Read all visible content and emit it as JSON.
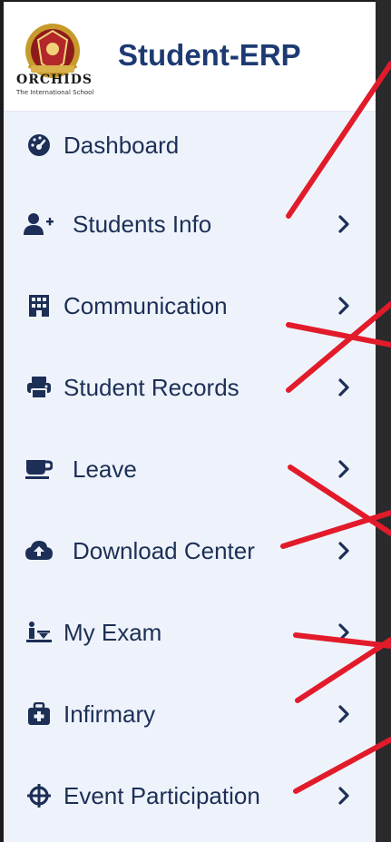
{
  "header": {
    "brand": "Student-ERP",
    "logo_name": "ORCHIDS",
    "logo_subtitle": "The International School"
  },
  "colors": {
    "sidebar_bg": "#eef3fb",
    "text": "#1d2f57",
    "brand": "#1d3a73",
    "annotation": "#e21b2b"
  },
  "sidebar": {
    "items": [
      {
        "label": "Dashboard",
        "icon": "dashboard-icon",
        "has_chevron": false
      },
      {
        "label": "Students Info",
        "icon": "add-user-icon",
        "has_chevron": true
      },
      {
        "label": "Communication",
        "icon": "building-icon",
        "has_chevron": true
      },
      {
        "label": "Student Records",
        "icon": "printer-icon",
        "has_chevron": true
      },
      {
        "label": "Leave",
        "icon": "coffee-cup-icon",
        "has_chevron": true
      },
      {
        "label": "Download Center",
        "icon": "cloud-download-icon",
        "has_chevron": true
      },
      {
        "label": "My Exam",
        "icon": "exam-icon",
        "has_chevron": true
      },
      {
        "label": "Infirmary",
        "icon": "medical-kit-icon",
        "has_chevron": true
      },
      {
        "label": "Event Participation",
        "icon": "crosshair-icon",
        "has_chevron": true
      }
    ]
  }
}
